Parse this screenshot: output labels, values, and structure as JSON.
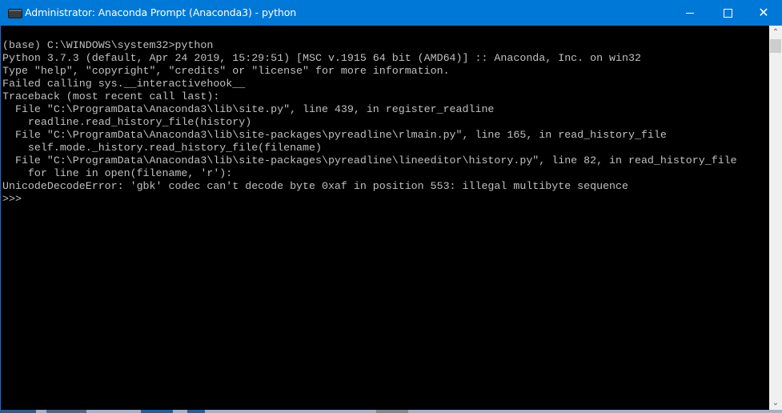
{
  "window": {
    "title": "Administrator: Anaconda Prompt (Anaconda3) - python",
    "icon": "console-icon",
    "controls": {
      "minimize": "minimize-icon",
      "maximize": "maximize-icon",
      "close": "close-icon",
      "close_glyph": "✕"
    },
    "accent_color": "#0078d7"
  },
  "console": {
    "lines": [
      "(base) C:\\WINDOWS\\system32>python",
      "Python 3.7.3 (default, Apr 24 2019, 15:29:51) [MSC v.1915 64 bit (AMD64)] :: Anaconda, Inc. on win32",
      "Type \"help\", \"copyright\", \"credits\" or \"license\" for more information.",
      "Failed calling sys.__interactivehook__",
      "Traceback (most recent call last):",
      "  File \"C:\\ProgramData\\Anaconda3\\lib\\site.py\", line 439, in register_readline",
      "    readline.read_history_file(history)",
      "  File \"C:\\ProgramData\\Anaconda3\\lib\\site-packages\\pyreadline\\rlmain.py\", line 165, in read_history_file",
      "    self.mode._history.read_history_file(filename)",
      "  File \"C:\\ProgramData\\Anaconda3\\lib\\site-packages\\pyreadline\\lineeditor\\history.py\", line 82, in read_history_file",
      "    for line in open(filename, 'r'):",
      "UnicodeDecodeError: 'gbk' codec can't decode byte 0xaf in position 553: illegal multibyte sequence",
      ">>>"
    ],
    "text_color": "#c0c0c0",
    "background": "#000000"
  },
  "scrollbar": {
    "up_glyph": "⌃",
    "down_glyph": "⌄"
  }
}
